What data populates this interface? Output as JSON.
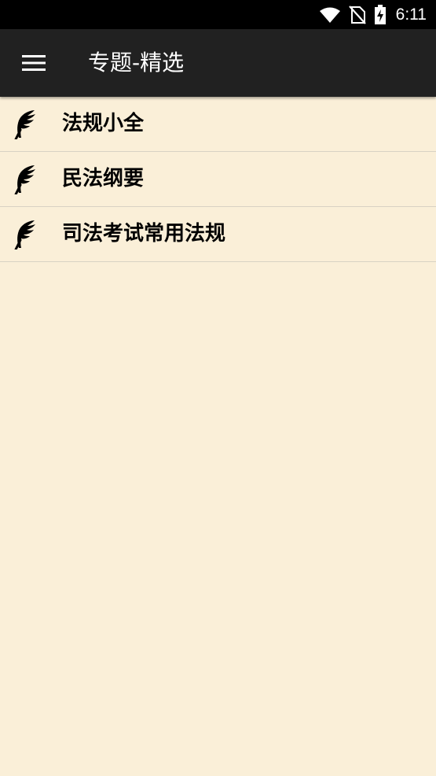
{
  "status_bar": {
    "time": "6:11",
    "icons": [
      "wifi-icon",
      "no-sim-icon",
      "battery-charging-icon"
    ]
  },
  "app_bar": {
    "menu_icon": "hamburger-menu-icon",
    "title": "专题-精选"
  },
  "list": {
    "icon": "quill-feather-icon",
    "items": [
      {
        "label": "法规小全"
      },
      {
        "label": "民法纲要"
      },
      {
        "label": "司法考试常用法规"
      }
    ]
  },
  "colors": {
    "background": "#FAEFD8",
    "app_bar": "#212121",
    "status_bar": "#000000",
    "divider": "#D8D2C4"
  }
}
